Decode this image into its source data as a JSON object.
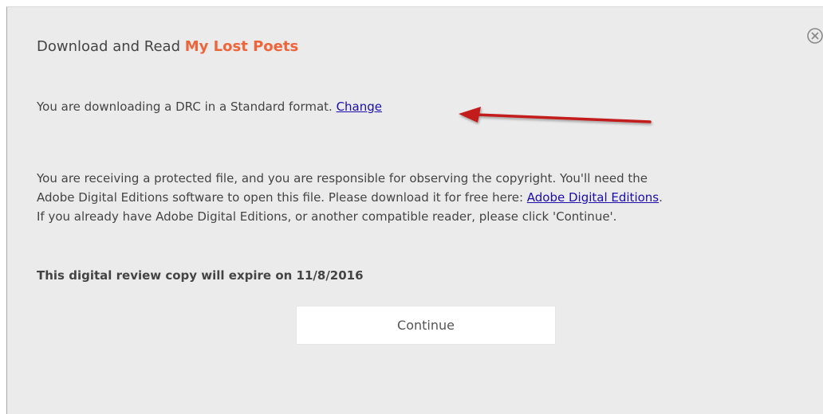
{
  "dialog": {
    "heading_prefix": "Download and Read ",
    "book_title": "My Lost Poets",
    "close_icon": "close-circle-icon",
    "format_text": "You are downloading a DRC in a Standard format. ",
    "change_link": "Change",
    "notice_part1": "You are receiving a protected file, and you are responsible for observing the copyright. You'll need the Adobe Digital Editions software to open this file. Please download it for free here: ",
    "ade_link": "Adobe Digital Editions",
    "notice_part2": ". If you already have Adobe Digital Editions, or another compatible reader, please click 'Continue'.",
    "expire_text": "This digital review copy will expire on 11/8/2016",
    "continue_label": "Continue"
  },
  "annotation": {
    "arrow_icon": "red-arrow-icon",
    "arrow_color": "#c21f1f"
  },
  "colors": {
    "background": "#ebebeb",
    "accent": "#f0643a",
    "link": "#1a0dab",
    "text": "#444444"
  }
}
